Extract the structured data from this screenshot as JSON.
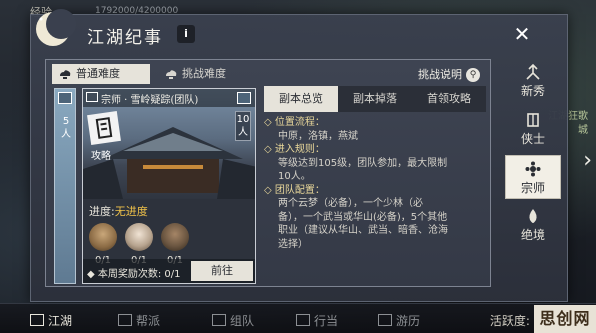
{
  "background": {
    "xp_label": "经验",
    "xp_value": "1792000/4200000",
    "side_text_1": "江湖狂歌",
    "side_text_2": "城"
  },
  "window": {
    "title": "江湖纪事",
    "info_label": "i",
    "close_label": "✕"
  },
  "tabs": [
    {
      "label": "普通难度",
      "active": true
    },
    {
      "label": "挑战难度",
      "active": false
    }
  ],
  "challenge_explain": "挑战说明",
  "side_card": {
    "players": "5\n人"
  },
  "dungeon": {
    "name": "宗师 · 雪岭疑踪(团队)",
    "players": "10\n人",
    "guide_label": "攻略",
    "progress_label": "进度:",
    "progress_value": "无进度",
    "bosses": [
      {
        "count": "0/1",
        "color": "#8a6a44"
      },
      {
        "count": "0/1",
        "color": "#b7a48f"
      },
      {
        "count": "0/1",
        "color": "#6b5641"
      }
    ],
    "weekly_reward": "本周奖励次数: 0/1",
    "go_button": "前往"
  },
  "detail_tabs": [
    {
      "label": "副本总览",
      "active": true
    },
    {
      "label": "副本掉落",
      "active": false
    },
    {
      "label": "首领攻略",
      "active": false
    }
  ],
  "detail": {
    "section1_title": "位置流程：",
    "section1_body": "中原，洛镇，燕斌",
    "section2_title": "进入规则：",
    "section2_line1": "等级达到105级，团队参加，最大限制",
    "section2_line2": "10人。",
    "section3_title": "团队配置：",
    "section3_line1": "两个云梦（必备），一个少林（必",
    "section3_line2": "备），一个武当或华山(必备)，5个其他",
    "section3_line3": "职业（建议从华山、武当、暗香、沧海",
    "section3_line4": "选择）"
  },
  "right_nav": [
    {
      "label": "新秀",
      "active": false
    },
    {
      "label": "侠士",
      "active": false
    },
    {
      "label": "宗师",
      "active": true
    },
    {
      "label": "绝境",
      "active": false
    }
  ],
  "bottom_bar": {
    "items": [
      {
        "label": "江湖",
        "active": true
      },
      {
        "label": "帮派",
        "active": false
      },
      {
        "label": "组队",
        "active": false
      },
      {
        "label": "行当",
        "active": false
      },
      {
        "label": "游历",
        "active": false
      }
    ],
    "activity": "活跃度: 15/100",
    "watermark": "思创网"
  },
  "colors": {
    "accent_gold": "#f0c24a",
    "panel_bg": "#3a404e",
    "active_tab": "#e6e3da"
  }
}
